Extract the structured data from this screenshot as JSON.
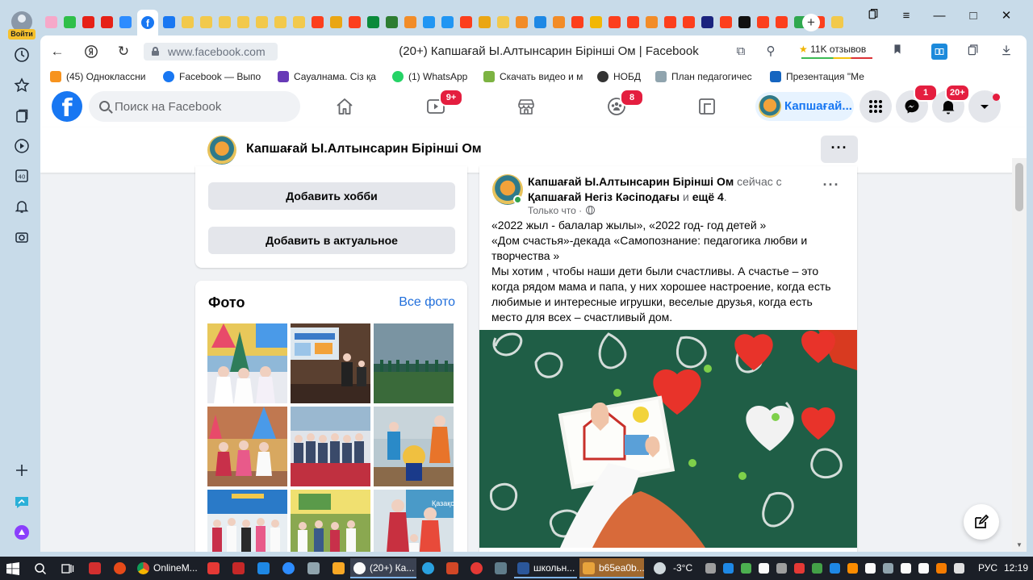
{
  "browser": {
    "sidebar": {
      "login_label": "Войти"
    },
    "window_controls": {
      "minimize": "—",
      "maximize": "□",
      "close": "✕"
    },
    "tabs": {
      "active_title": "(20+) Капшағай Ы.Алтынсарин Бірінші Ом | Facebook",
      "favicon_colors": [
        "#f6a8c9",
        "#2fbf4a",
        "#e62117",
        "#e62117",
        "#2d8cff",
        "#1877f2",
        "#f2c94c",
        "#f2c94c",
        "#f2c94c",
        "#f2c94c",
        "#f2c94c",
        "#f2c94c",
        "#f2c94c",
        "#fc3f1d",
        "#eaa614",
        "#fc3f1d",
        "#0a8a3b",
        "#2e7d32",
        "#f28c28",
        "#2196f3",
        "#2196f3",
        "#fc3f1d",
        "#eaa614",
        "#f2c94c",
        "#f28c28",
        "#1e88e5",
        "#f28c28",
        "#fc3f1d",
        "#f2b705",
        "#fc3f1d",
        "#fc3f1d",
        "#f28c28",
        "#fc3f1d",
        "#fc3f1d",
        "#1a237e",
        "#fc3f1d",
        "#111111",
        "#fc3f1d",
        "#fc3f1d",
        "#2fa84f",
        "#fc3f1d",
        "#f2c94c"
      ]
    },
    "address_bar": {
      "url": "www.facebook.com",
      "page_title": "(20+) Капшағай Ы.Алтынсарин Бірінші Ом | Facebook",
      "reviews": "11K отзывов"
    },
    "bookmarks": [
      {
        "label": "(45) Одноклассни",
        "color": "#f7931e"
      },
      {
        "label": "Facebook — Выпо",
        "color": "#1877f2"
      },
      {
        "label": "Сауалнама. Сіз қа",
        "color": "#673ab7"
      },
      {
        "label": "(1) WhatsApp",
        "color": "#25d366"
      },
      {
        "label": "Скачать видео и м",
        "color": "#7cb342"
      },
      {
        "label": "НОБД",
        "color": "#333333"
      },
      {
        "label": "План педагогичес",
        "color": "#90a4ae"
      },
      {
        "label": "Презентация \"Ме",
        "color": "#1565c0"
      }
    ]
  },
  "facebook": {
    "search_placeholder": "Поиск на Facebook",
    "badges": {
      "watch": "9+",
      "groups": "8",
      "messenger": "1",
      "notifications": "20+"
    },
    "profile_name": "Капшағай...",
    "page_name": "Капшағай Ы.Алтынсарин Бірінші Ом",
    "page_more": "···",
    "intro_card": {
      "add_hobby": "Добавить хобби",
      "add_featured": "Добавить в актуальное"
    },
    "photos": {
      "title": "Фото",
      "see_all": "Все фото"
    },
    "post": {
      "author": "Капшағай Ы.Алтынсарин Бірінші Ом",
      "with_text": " сейчас с ",
      "tagged": "Қапшағай Негіз Кәсіподағы",
      "and_text": " и ",
      "more_tagged": "ещё 4",
      "period": ".",
      "time": "Только что ·",
      "dots": "···",
      "lines": [
        "«2022 жыл - балалар жылы», «2022 год- год детей »",
        "«Дом счастья»-декада «Самопознание: педагогика любви и творчества »",
        "Мы хотим , чтобы наши дети были счастливы. А счастье – это когда рядом мама и папа, у них хорошее настроение, когда есть любимые и интересные игрушки, веселые друзья, когда есть место для всех – счастливый дом."
      ]
    }
  },
  "taskbar": {
    "items": [
      {
        "label": "OnlineM...",
        "color": "#db4437"
      },
      {
        "label": "(20+) Ка...",
        "color": "#fc3f1d"
      },
      {
        "label": "школьн...",
        "color": "#2b579a"
      },
      {
        "label": "b65ea0b...",
        "color": "#e8a33c"
      }
    ],
    "weather": "-3°C",
    "language": "РУС",
    "clock": "12:19"
  }
}
